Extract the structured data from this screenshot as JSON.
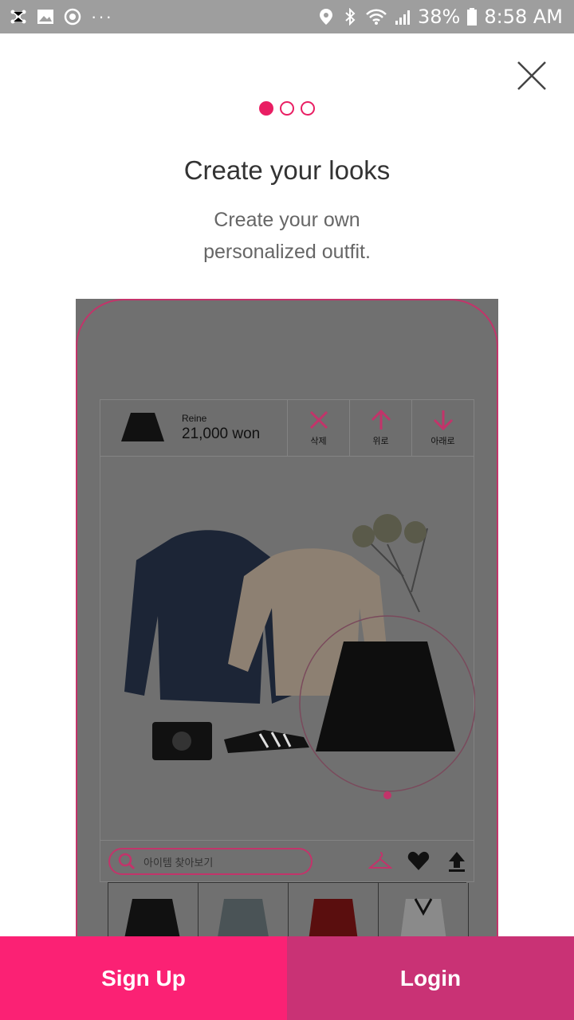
{
  "status_bar": {
    "battery": "38%",
    "time": "8:58 AM",
    "more": "···"
  },
  "pager": {
    "total": 3,
    "active": 0
  },
  "title": "Create your looks",
  "subtitle_line1": "Create your own",
  "subtitle_line2": "personalized outfit.",
  "preview": {
    "item_brand": "Reine",
    "item_price": "21,000 won",
    "actions": [
      {
        "label": "삭제",
        "icon": "x-icon"
      },
      {
        "label": "위로",
        "icon": "arrow-up-icon"
      },
      {
        "label": "아래로",
        "icon": "arrow-down-icon"
      }
    ],
    "search_placeholder": "아이템 찾아보기"
  },
  "buttons": {
    "signup": "Sign Up",
    "login": "Login"
  },
  "colors": {
    "accent": "#e91e63",
    "signup_bg": "#fb2174",
    "login_bg": "#c93275"
  }
}
